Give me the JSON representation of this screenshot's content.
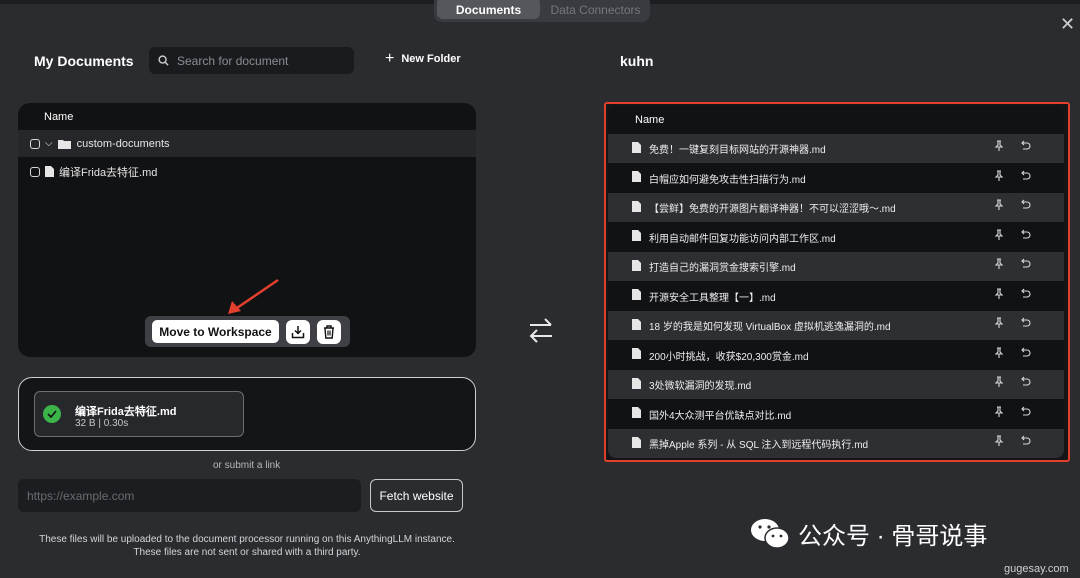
{
  "tabs": [
    {
      "label": "Documents",
      "active": true
    },
    {
      "label": "Data Connectors",
      "active": false
    }
  ],
  "my_documents": {
    "title": "My Documents",
    "search_placeholder": "Search for document",
    "new_folder_label": "New Folder",
    "column_name": "Name",
    "rows": [
      {
        "label": "custom-documents",
        "type": "folder"
      },
      {
        "label": "编译Frida去特征.md",
        "type": "file"
      }
    ]
  },
  "toolbar": {
    "move_label": "Move to Workspace"
  },
  "upload": {
    "file_name": "编译Frida去特征.md",
    "file_meta": "32 B | 0.30s",
    "or_text": "or submit a link",
    "url_placeholder": "https://example.com",
    "fetch_label": "Fetch website",
    "notice_line1": "These files will be uploaded to the document processor running on this AnythingLLM instance.",
    "notice_line2": "These files are not sent or shared with a third party."
  },
  "workspace": {
    "title": "kuhn",
    "column_name": "Name",
    "files": [
      "免费！一键复刻目标网站的开源神器.md",
      "白帽应如何避免攻击性扫描行为.md",
      "【尝鲜】免费的开源图片翻译神器！不可以涩涩哦～.md",
      "利用自动邮件回复功能访问内部工作区.md",
      "打造自己的漏洞赏金搜索引擎.md",
      "开源安全工具整理【一】.md",
      "18 岁的我是如何发现 VirtualBox 虚拟机逃逸漏洞的.md",
      "200小时挑战，收获$20,300赏金.md",
      "3处微软漏洞的发现.md",
      "国外4大众测平台优缺点对比.md",
      "黑掉Apple 系列 - 从 SQL 注入到远程代码执行.md"
    ]
  },
  "watermark": {
    "text": "公众号 · 骨哥说事",
    "site": "gugesay.com"
  },
  "colors": {
    "highlight_border": "#e2402d",
    "success": "#3bb54a",
    "arrow": "#e2402d"
  }
}
